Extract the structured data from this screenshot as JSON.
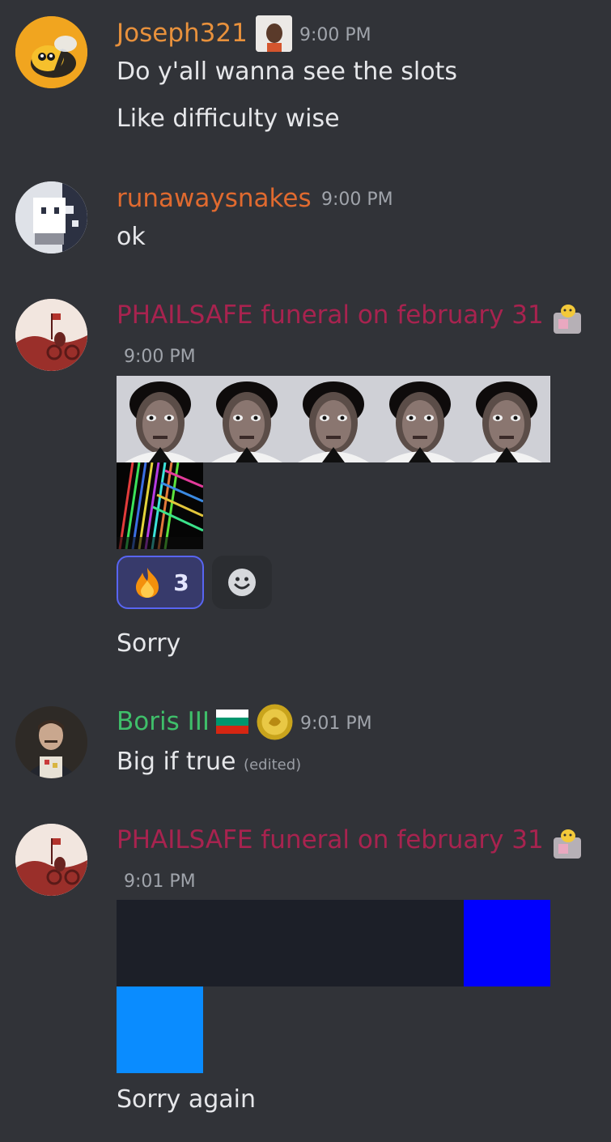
{
  "messages": [
    {
      "author": "Joseph321",
      "author_color": "#e8913c",
      "time": "9:00 PM",
      "lines": [
        "Do y'all wanna see the slots",
        "Like difficulty wise"
      ]
    },
    {
      "author": "runawaysnakes",
      "author_color": "#e06a2f",
      "time": "9:00 PM",
      "lines": [
        "ok"
      ]
    },
    {
      "author": "PHAILSAFE funeral on february 31",
      "author_color": "#a8234f",
      "time": "9:00 PM",
      "reactions": [
        {
          "icon": "fire-emoji-icon",
          "count": "3",
          "selected": true
        }
      ],
      "lines": [
        "Sorry"
      ]
    },
    {
      "author": "Boris III",
      "author_color": "#3fbf6a",
      "time": "9:01 PM",
      "text": "Big if true",
      "edited_label": "(edited)"
    },
    {
      "author": "PHAILSAFE funeral on february 31",
      "author_color": "#a8234f",
      "time": "9:01 PM",
      "lines": [
        "Sorry again"
      ]
    }
  ],
  "colors": {
    "background": "#313338",
    "reaction_selected_bg": "#373a6b",
    "reaction_selected_border": "#5865f2",
    "blue_tile": "#0000ff",
    "light_blue_tile": "#0a8cff",
    "dark_tile": "#1c1f28"
  }
}
